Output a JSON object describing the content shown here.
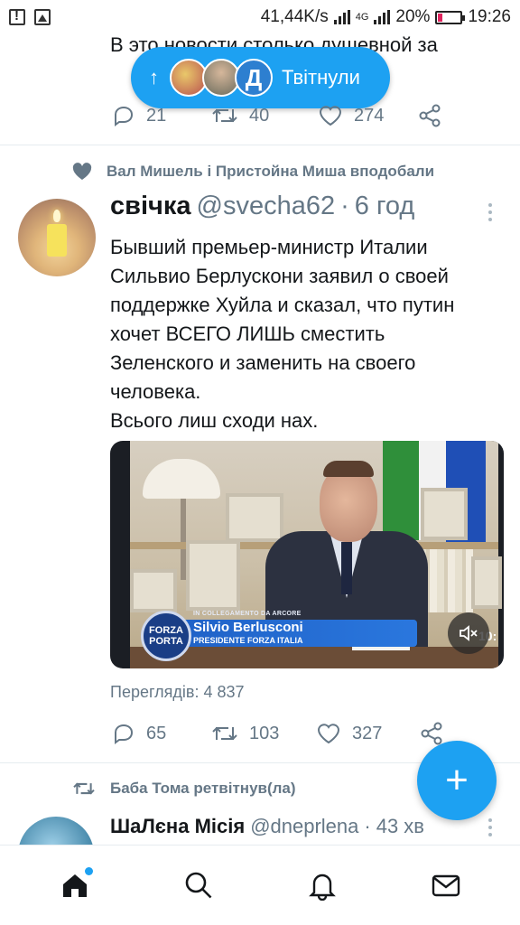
{
  "status_bar": {
    "speed": "41,44K/s",
    "network": "4G",
    "battery": "20%",
    "time": "19:26"
  },
  "top_tweet": {
    "text_partial": "В это новости столько душевной за",
    "replies": "21",
    "retweets": "40",
    "likes": "274"
  },
  "toast": {
    "label": "Твітнули",
    "avatar3_letter": "Д"
  },
  "main_tweet": {
    "context": "Вал Мишель і Пристойна Миша вподобали",
    "name": "свічка",
    "handle": "@svecha62",
    "separator": "·",
    "time": "6 год",
    "lines": [
      "Бывший премьер-министр Италии",
      "Сильвио Берлускони заявил о своей",
      "поддержке Хуйла и сказал, что путин",
      "хочет ВСЕГО ЛИШЬ сместить",
      "Зеленского и заменить на своего",
      "человека.",
      "Всього лиш сходи нах."
    ],
    "video": {
      "overlay_caption": "IN COLLEGAMENTO DA ARCORE",
      "lower_third_name": "Silvio Berlusconi",
      "lower_third_role": "PRESIDENTE FORZA ITALIA",
      "logo_line1": "FORZA",
      "logo_line2": "PORTA",
      "clock": "10:"
    },
    "views": "Переглядів: 4 837",
    "replies": "65",
    "retweets": "103",
    "likes": "327"
  },
  "next_tweet": {
    "context": "Баба Тома ретвітнув(ла)",
    "name": "ШаЛєна Місія",
    "handle": "@dneprlena",
    "separator": "·",
    "time": "43 хв"
  },
  "fab": {
    "symbol": "+"
  },
  "icons": {
    "home": "home-icon",
    "search": "search-icon",
    "notifications": "bell-icon",
    "messages": "mail-icon"
  },
  "colors": {
    "accent": "#1da1f2",
    "secondary_text": "#657786"
  }
}
